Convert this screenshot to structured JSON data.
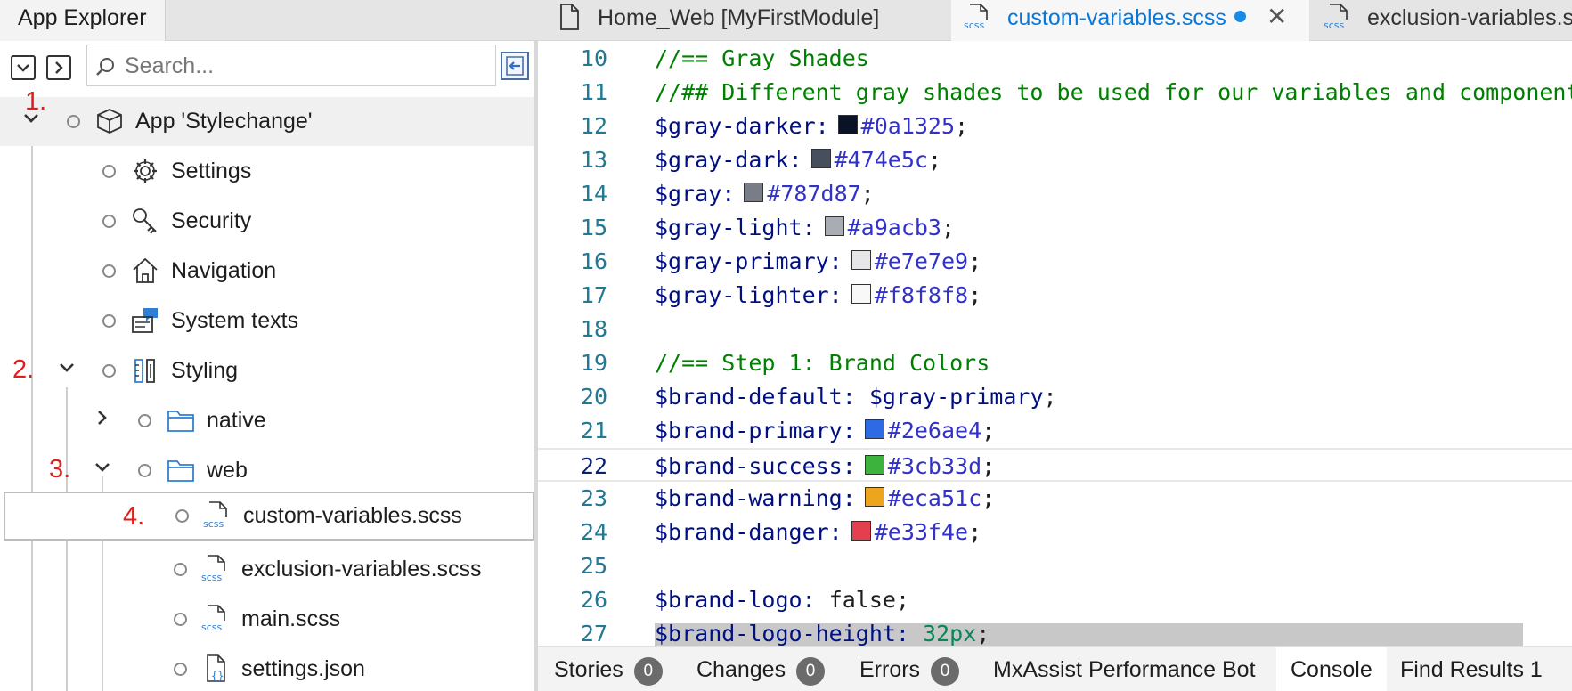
{
  "explorer": {
    "title": "App Explorer",
    "search": {
      "placeholder": "Search..."
    },
    "tree": [
      {
        "label": "App 'Stylechange'",
        "icon": "cube-icon",
        "annotation": "1."
      },
      {
        "label": "Settings",
        "icon": "gear-icon"
      },
      {
        "label": "Security",
        "icon": "key-icon"
      },
      {
        "label": "Navigation",
        "icon": "home-icon"
      },
      {
        "label": "System texts",
        "icon": "system-texts-icon"
      },
      {
        "label": "Styling",
        "icon": "styling-icon",
        "annotation": "2."
      },
      {
        "label": "native",
        "icon": "folder-icon"
      },
      {
        "label": "web",
        "icon": "folder-icon",
        "annotation": "3."
      },
      {
        "label": "custom-variables.scss",
        "icon": "scss-file-icon",
        "annotation": "4."
      },
      {
        "label": "exclusion-variables.scss",
        "icon": "scss-file-icon"
      },
      {
        "label": "main.scss",
        "icon": "scss-file-icon"
      },
      {
        "label": "settings.json",
        "icon": "json-file-icon"
      }
    ]
  },
  "tabs": [
    {
      "label": "Home_Web [MyFirstModule]",
      "icon": "page-icon"
    },
    {
      "label": "custom-variables.scss",
      "icon": "scss-file-icon",
      "active": true,
      "modified": true,
      "close": "✕"
    },
    {
      "label": "exclusion-variables.scss",
      "icon": "scss-file-icon"
    }
  ],
  "editor": {
    "lines": [
      {
        "n": "10",
        "text": "//== Gray Shades"
      },
      {
        "n": "11",
        "text": "//## Different gray shades to be used for our variables and components"
      },
      {
        "n": "12",
        "var": "$gray-darker:",
        "color": "#0a1325",
        "value": "#0a1325"
      },
      {
        "n": "13",
        "var": "$gray-dark:",
        "color": "#474e5c",
        "value": "#474e5c"
      },
      {
        "n": "14",
        "var": "$gray:",
        "color": "#787d87",
        "value": "#787d87"
      },
      {
        "n": "15",
        "var": "$gray-light:",
        "color": "#a9acb3",
        "value": "#a9acb3"
      },
      {
        "n": "16",
        "var": "$gray-primary:",
        "color": "#e7e7e9",
        "value": "#e7e7e9"
      },
      {
        "n": "17",
        "var": "$gray-lighter:",
        "color": "#f8f8f8",
        "value": "#f8f8f8"
      },
      {
        "n": "18",
        "text": ""
      },
      {
        "n": "19",
        "text": "//== Step 1: Brand Colors"
      },
      {
        "n": "20",
        "var": "$brand-default:",
        "value": "$gray-primary"
      },
      {
        "n": "21",
        "var": "$brand-primary:",
        "color": "#2e6ae4",
        "value": "#2e6ae4"
      },
      {
        "n": "22",
        "var": "$brand-success:",
        "color": "#3cb33d",
        "value": "#3cb33d"
      },
      {
        "n": "23",
        "var": "$brand-warning:",
        "color": "#eca51c",
        "value": "#eca51c"
      },
      {
        "n": "24",
        "var": "$brand-danger:",
        "color": "#e33f4e",
        "value": "#e33f4e"
      },
      {
        "n": "25",
        "text": ""
      },
      {
        "n": "26",
        "var": "$brand-logo:",
        "value": "false"
      },
      {
        "n": "27",
        "var": "$brand-logo-height:",
        "value": "32px"
      }
    ],
    "current_line": "22"
  },
  "bottom_tabs": [
    {
      "label": "Stories",
      "badge": "0"
    },
    {
      "label": "Changes",
      "badge": "0"
    },
    {
      "label": "Errors",
      "badge": "0"
    },
    {
      "label": "MxAssist Performance Bot"
    },
    {
      "label": "Console",
      "active": true
    },
    {
      "label": "Find Results 1"
    }
  ],
  "colors": {
    "accent": "#0a78d8",
    "annotation": "#e01e1e",
    "comment": "#008000",
    "variable": "#001080",
    "hex_value": "#3232c8"
  }
}
